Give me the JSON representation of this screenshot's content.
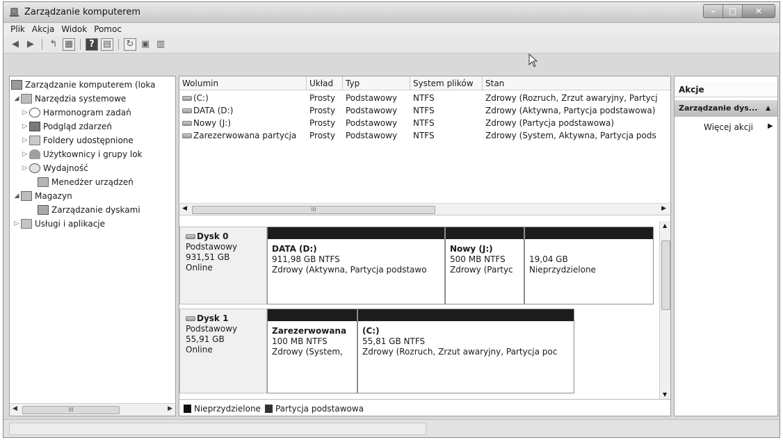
{
  "window": {
    "title": "Zarządzanie komputerem"
  },
  "menu": [
    "Plik",
    "Akcja",
    "Widok",
    "Pomoc"
  ],
  "tree": {
    "root": "Zarządzanie komputerem (loka",
    "items": [
      {
        "label": "Narzędzia systemowe"
      },
      {
        "label": "Harmonogram zadań"
      },
      {
        "label": "Podgląd zdarzeń"
      },
      {
        "label": "Foldery udostępnione"
      },
      {
        "label": "Użytkownicy i grupy lok"
      },
      {
        "label": "Wydajność"
      },
      {
        "label": "Menedżer urządzeń"
      },
      {
        "label": "Magazyn"
      },
      {
        "label": "Zarządzanie dyskami"
      },
      {
        "label": "Usługi i aplikacje"
      }
    ]
  },
  "volumes": {
    "columns": [
      "Wolumin",
      "Układ",
      "Typ",
      "System plików",
      "Stan"
    ],
    "rows": [
      {
        "name": "(C:)",
        "layout": "Prosty",
        "type": "Podstawowy",
        "fs": "NTFS",
        "status": "Zdrowy (Rozruch, Zrzut awaryjny, Partycj"
      },
      {
        "name": "DATA (D:)",
        "layout": "Prosty",
        "type": "Podstawowy",
        "fs": "NTFS",
        "status": "Zdrowy (Aktywna, Partycja podstawowa)"
      },
      {
        "name": "Nowy (J:)",
        "layout": "Prosty",
        "type": "Podstawowy",
        "fs": "NTFS",
        "status": "Zdrowy (Partycja podstawowa)"
      },
      {
        "name": "Zarezerwowana partycja",
        "layout": "Prosty",
        "type": "Podstawowy",
        "fs": "NTFS",
        "status": "Zdrowy (System, Aktywna, Partycja pods"
      }
    ]
  },
  "disks": [
    {
      "name": "Dysk 0",
      "kind": "Podstawowy",
      "size": "931,51 GB",
      "state": "Online",
      "partitions": [
        {
          "name": "DATA  (D:)",
          "size": "911,98 GB NTFS",
          "status": "Zdrowy (Aktywna, Partycja podstawo"
        },
        {
          "name": "Nowy  (J:)",
          "size": "500 MB NTFS",
          "status": "Zdrowy (Partyc"
        },
        {
          "name": "",
          "size": "19,04 GB",
          "status": "Nieprzydzielone"
        }
      ]
    },
    {
      "name": "Dysk 1",
      "kind": "Podstawowy",
      "size": "55,91 GB",
      "state": "Online",
      "partitions": [
        {
          "name": "Zarezerwowana",
          "size": "100 MB NTFS",
          "status": "Zdrowy (System,"
        },
        {
          "name": "(C:)",
          "size": "55,81 GB NTFS",
          "status": "Zdrowy (Rozruch, Zrzut awaryjny, Partycja poc"
        }
      ]
    }
  ],
  "legend": {
    "unallocated": "Nieprzydzielone",
    "primary": "Partycja podstawowa"
  },
  "actions": {
    "title": "Akcje",
    "selected": "Zarządzanie dys...",
    "more": "Więcej akcji"
  },
  "scroll": {
    "mark": "III"
  },
  "colors": {
    "unallocated": "#1a1a1a",
    "primary": "#2b2b2b",
    "selected_bg": "#c9c9c9"
  }
}
